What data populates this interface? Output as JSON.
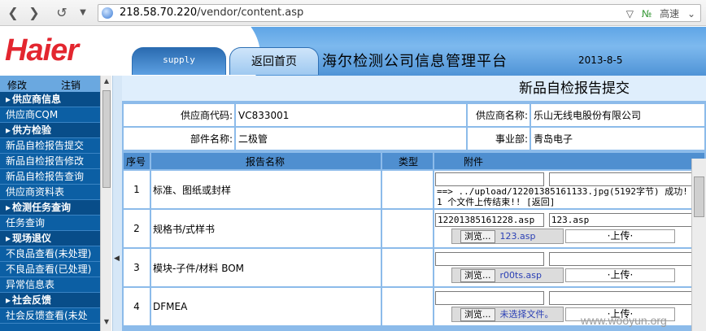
{
  "browser": {
    "back_icon": "back-arrow-icon",
    "forward_icon": "forward-arrow-icon",
    "reload_icon": "reload-icon",
    "url_host": "218.58.70.220",
    "url_path": "/vendor/content.asp",
    "speed_label": "高速"
  },
  "header": {
    "logo": "Haier",
    "tab_supply": "supply",
    "tab_home": "返回首页",
    "title": "海尔检测公司信息管理平台",
    "date": "2013-8-5"
  },
  "sidebar": {
    "top_left": "修改",
    "top_right": "注销",
    "items": [
      {
        "type": "section",
        "label": "供应商信息"
      },
      {
        "type": "link",
        "label": "供应商CQM"
      },
      {
        "type": "section",
        "label": "供方检验"
      },
      {
        "type": "link",
        "label": "新品自检报告提交"
      },
      {
        "type": "link",
        "label": "新品自检报告修改"
      },
      {
        "type": "link",
        "label": "新品自检报告查询"
      },
      {
        "type": "link",
        "label": "供应商资料表"
      },
      {
        "type": "section",
        "label": "检测任务查询"
      },
      {
        "type": "link",
        "label": "任务查询"
      },
      {
        "type": "section",
        "label": "现场退仪"
      },
      {
        "type": "link",
        "label": "不良品查看(未处理)"
      },
      {
        "type": "link",
        "label": "不良品查看(已处理)"
      },
      {
        "type": "link",
        "label": "异常信息表"
      },
      {
        "type": "section",
        "label": "社会反馈"
      },
      {
        "type": "link",
        "label": "社会反馈查看(未处"
      }
    ]
  },
  "main": {
    "title": "新品自检报告提交",
    "supplier_code_label": "供应商代码:",
    "supplier_code": "VC833001",
    "supplier_name_label": "供应商名称:",
    "supplier_name": "乐山无线电股份有限公司",
    "part_name_label": "部件名称:",
    "part_name": "二极管",
    "division_label": "事业部:",
    "division": "青岛电子",
    "columns": [
      "序号",
      "报告名称",
      "类型",
      "附件"
    ],
    "rows": [
      {
        "no": "1",
        "name": "标准、图纸或封样",
        "input1": "",
        "input2": "",
        "msg1": "==> ../upload/12201385161133.jpg(5192字节) 成功!",
        "msg2": "1 个文件上传结束!! [返回]"
      },
      {
        "no": "2",
        "name": "规格书/式样书",
        "input1": "12201385161228.asp",
        "input2": "123.asp",
        "browse": "浏览...",
        "file": "123.asp",
        "upload": "·上传·"
      },
      {
        "no": "3",
        "name": "模块-子件/材料 BOM",
        "input1": "",
        "input2": "",
        "browse": "浏览...",
        "file": "r00ts.asp",
        "upload": "·上传·"
      },
      {
        "no": "4",
        "name": "DFMEA",
        "input1": "",
        "input2": "",
        "browse": "浏览...",
        "file": "未选择文件。",
        "upload": "·上传·"
      }
    ]
  },
  "watermark": "www.wooyun.org",
  "colors": {
    "brand_red": "#e3262f",
    "sidebar_bg": "#0c5fa4",
    "accent_blue": "#4f8fd0"
  }
}
